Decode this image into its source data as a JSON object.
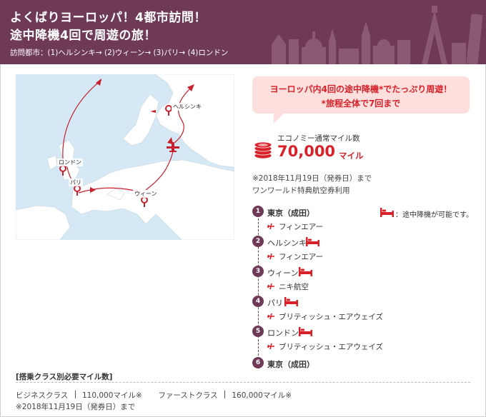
{
  "header": {
    "title_line1": "よくばりヨーロッパ！4都市訪問！",
    "title_line2": "途中降機4回で周遊の旅！",
    "route": "訪問都市：(1)ヘルシンキ→ (2)ウィーン→ (3)パリ→ (4)ロンドン"
  },
  "map": {
    "cities": {
      "helsinki": "ヘルシンキ",
      "london": "ロンドン",
      "paris": "パリ",
      "vienna": "ウィーン"
    }
  },
  "bubble": {
    "line1": "ヨーロッパ内4回の途中降機*でたっぷり周遊！",
    "line2": "*旅程全体で7回まで"
  },
  "miles": {
    "label": "エコノミー通常マイル数",
    "value": "70,000",
    "unit": "マイル",
    "note1": "※2018年11月19日（発券日）まで",
    "note2": "ワンワールド特典航空券利用"
  },
  "legend": {
    "text": "：途中降機が可能です。"
  },
  "itinerary": {
    "stops": [
      {
        "num": "1",
        "name": "東京（成田）"
      },
      {
        "num": "2",
        "name": "ヘルシンキ"
      },
      {
        "num": "3",
        "name": "ウィーン"
      },
      {
        "num": "4",
        "name": "パリ"
      },
      {
        "num": "5",
        "name": "ロンドン"
      },
      {
        "num": "6",
        "name": "東京（成田）"
      }
    ],
    "airlines": [
      "フィンエアー",
      "フィンエアー",
      "ニキ航空",
      "ブリティッシュ・エアウェイズ",
      "ブリティッシュ・エアウェイズ"
    ]
  },
  "fares": {
    "section_title": "[搭乗クラス別必要マイル数]",
    "business_label": "ビジネスクラス",
    "business_value": "110,000マイル※",
    "first_label": "ファーストクラス",
    "first_value": "160,000マイル※",
    "note": "※2018年11月19日（発券日）まで"
  },
  "colors": {
    "brand": "#6e3a56",
    "accent": "#d9212a",
    "bubble": "#fde0de"
  }
}
